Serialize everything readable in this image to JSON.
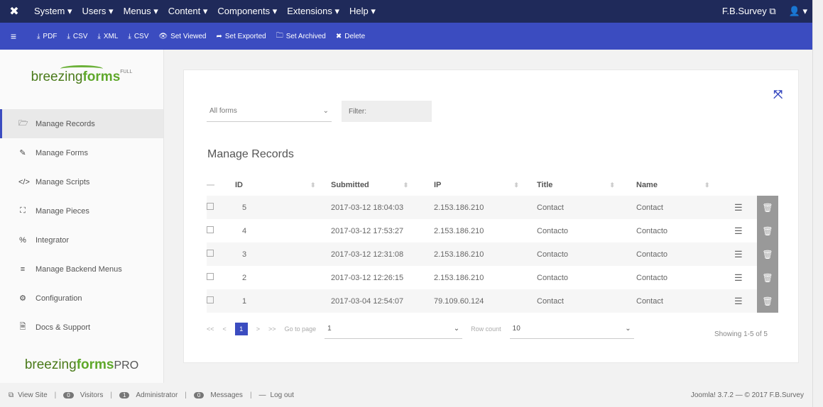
{
  "topnav": {
    "menus": [
      "System ▾",
      "Users ▾",
      "Menus ▾",
      "Content ▾",
      "Components ▾",
      "Extensions ▾",
      "Help ▾"
    ],
    "site_name": "F.B.Survey ⧉",
    "user_menu": "👤 ▾"
  },
  "toolbar": {
    "menu_icon": "≡",
    "buttons": [
      {
        "icon": "⤓",
        "label": "PDF",
        "icon_name": "download-icon"
      },
      {
        "icon": "⤓",
        "label": "CSV",
        "icon_name": "download-icon"
      },
      {
        "icon": "⤓",
        "label": "XML",
        "icon_name": "download-icon"
      },
      {
        "icon": "⤓",
        "label": "CSV",
        "icon_name": "download-icon"
      },
      {
        "icon": "👁",
        "label": "Set Viewed",
        "icon_name": "eye-icon"
      },
      {
        "icon": "➦",
        "label": "Set Exported",
        "icon_name": "share-icon"
      },
      {
        "icon": "🗀",
        "label": "Set Archived",
        "icon_name": "archive-icon"
      },
      {
        "icon": "✖",
        "label": "Delete",
        "icon_name": "delete-icon"
      }
    ]
  },
  "sidebar": {
    "logo_text_a": "breezing",
    "logo_text_b": "forms",
    "logo_sup": "FULL",
    "logo2_sup": "PRO",
    "items": [
      {
        "icon": "🗁",
        "label": "Manage Records",
        "active": true
      },
      {
        "icon": "✎",
        "label": "Manage Forms"
      },
      {
        "icon": "</>",
        "label": "Manage Scripts"
      },
      {
        "icon": "⛶",
        "label": "Manage Pieces"
      },
      {
        "icon": "%",
        "label": "Integrator"
      },
      {
        "icon": "≡",
        "label": "Manage Backend Menus"
      },
      {
        "icon": "⚙",
        "label": "Configuration"
      },
      {
        "icon": "🗎",
        "label": "Docs & Support"
      }
    ]
  },
  "main": {
    "expand_icon": "⤧",
    "form_select": "All forms",
    "filter_placeholder": "Filter:",
    "title": "Manage Records",
    "columns": [
      "ID",
      "Submitted",
      "IP",
      "Title",
      "Name"
    ],
    "rows": [
      {
        "id": "5",
        "submitted": "2017-03-12 18:04:03",
        "ip": "2.153.186.210",
        "title": "Contact",
        "name": "Contact"
      },
      {
        "id": "4",
        "submitted": "2017-03-12 17:53:27",
        "ip": "2.153.186.210",
        "title": "Contacto",
        "name": "Contacto"
      },
      {
        "id": "3",
        "submitted": "2017-03-12 12:31:08",
        "ip": "2.153.186.210",
        "title": "Contacto",
        "name": "Contacto"
      },
      {
        "id": "2",
        "submitted": "2017-03-12 12:26:15",
        "ip": "2.153.186.210",
        "title": "Contacto",
        "name": "Contacto"
      },
      {
        "id": "1",
        "submitted": "2017-03-04 12:54:07",
        "ip": "79.109.60.124",
        "title": "Contact",
        "name": "Contact"
      }
    ],
    "pager": {
      "first": "<<",
      "prev": "<",
      "current": "1",
      "next": ">",
      "last": ">>",
      "goto_label": "Go to page",
      "goto_value": "1",
      "rowcount_label": "Row count",
      "rowcount_value": "10"
    },
    "showing": "Showing 1-5 of 5"
  },
  "status": {
    "view_site": "View Site",
    "visitors_count": "0",
    "visitors": "Visitors",
    "admin_count": "1",
    "admin": "Administrator",
    "messages_count": "0",
    "messages": "Messages",
    "logout": "Log out",
    "version": "Joomla! 3.7.2 — © 2017 F.B.Survey"
  },
  "colors": {
    "topnav": "#1f2a5a",
    "toolbar": "#3b4cc0",
    "brand_green": "#5fa82b"
  }
}
